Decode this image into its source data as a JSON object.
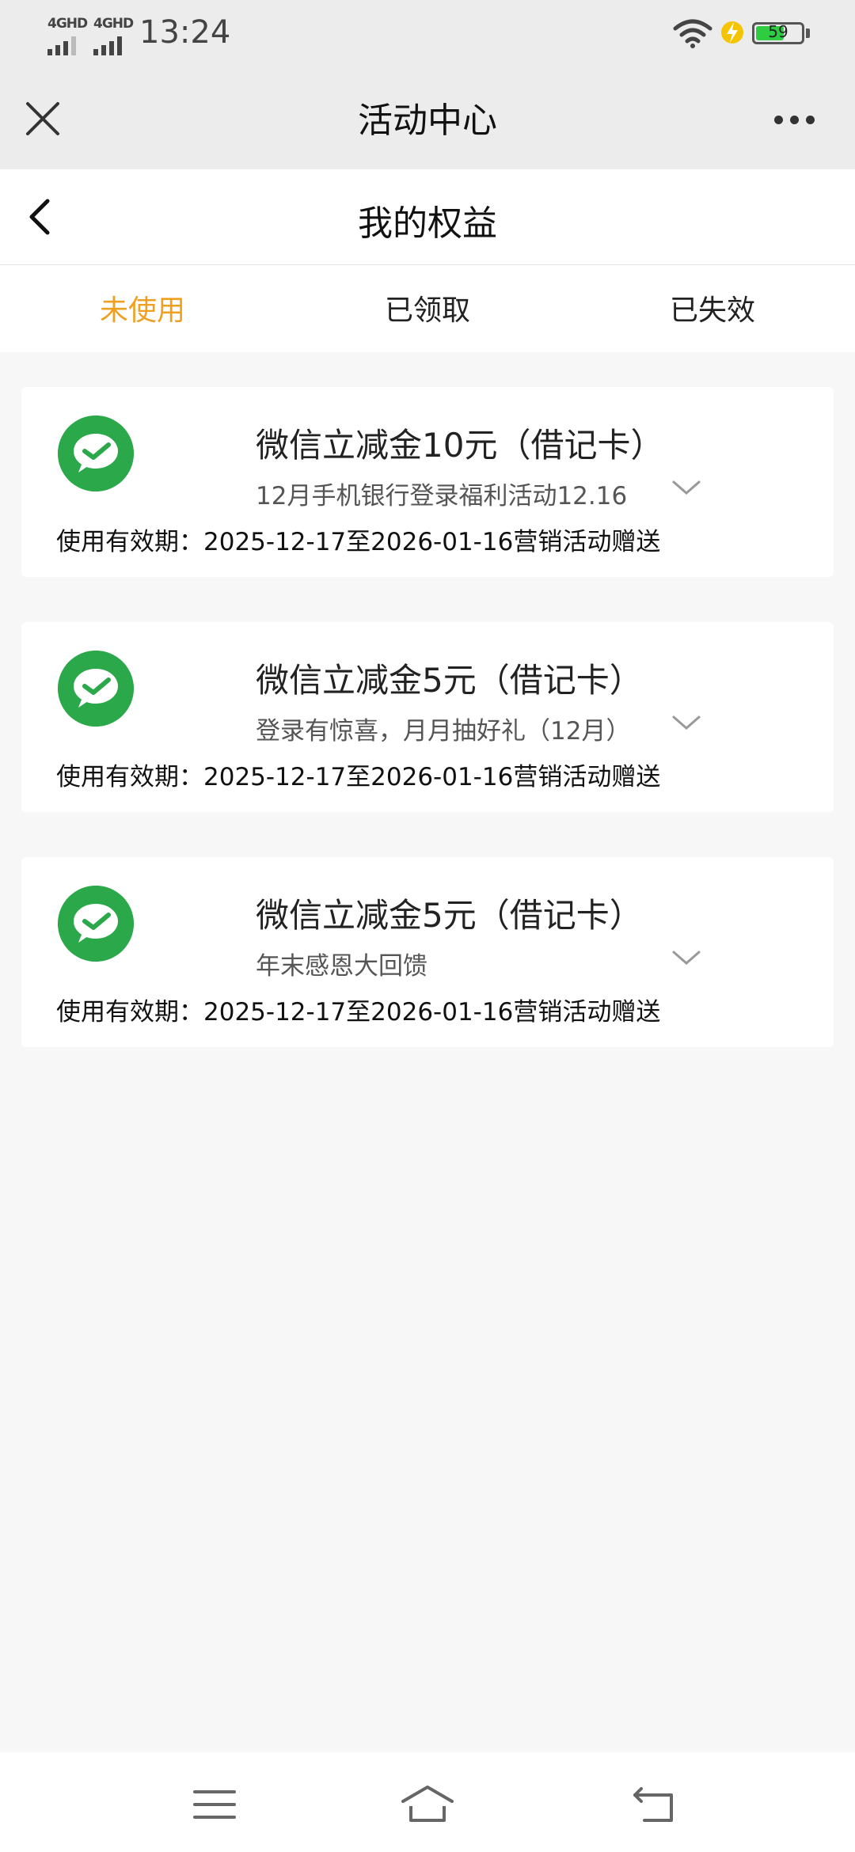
{
  "status_bar": {
    "signal1_label": "4GHD",
    "signal2_label": "4GHD",
    "time": "13:24",
    "battery_level": "59"
  },
  "header": {
    "title": "活动中心"
  },
  "page": {
    "title": "我的权益"
  },
  "tabs": [
    {
      "label": "未使用",
      "active": true
    },
    {
      "label": "已领取",
      "active": false
    },
    {
      "label": "已失效",
      "active": false
    }
  ],
  "cards": [
    {
      "title": "微信立减金10元（借记卡）",
      "subtitle": "12月手机银行登录福利活动12.16",
      "validity": "使用有效期：2025-12-17至2026-01-16营销活动赠送"
    },
    {
      "title": "微信立减金5元（借记卡）",
      "subtitle": "登录有惊喜，月月抽好礼（12月）",
      "validity": "使用有效期：2025-12-17至2026-01-16营销活动赠送"
    },
    {
      "title": "微信立减金5元（借记卡）",
      "subtitle": "年末感恩大回馈",
      "validity": "使用有效期：2025-12-17至2026-01-16营销活动赠送"
    }
  ],
  "colors": {
    "accent": "#f0a020",
    "wechat_green": "#2ba84a",
    "battery_green": "#2ecc40"
  },
  "icons": {
    "close": "close-icon",
    "more": "more-icon",
    "back": "back-arrow-icon",
    "card": "wechat-pay-icon",
    "expand": "chevron-down-icon",
    "menu": "menu-icon",
    "home": "home-icon",
    "return": "return-icon"
  }
}
